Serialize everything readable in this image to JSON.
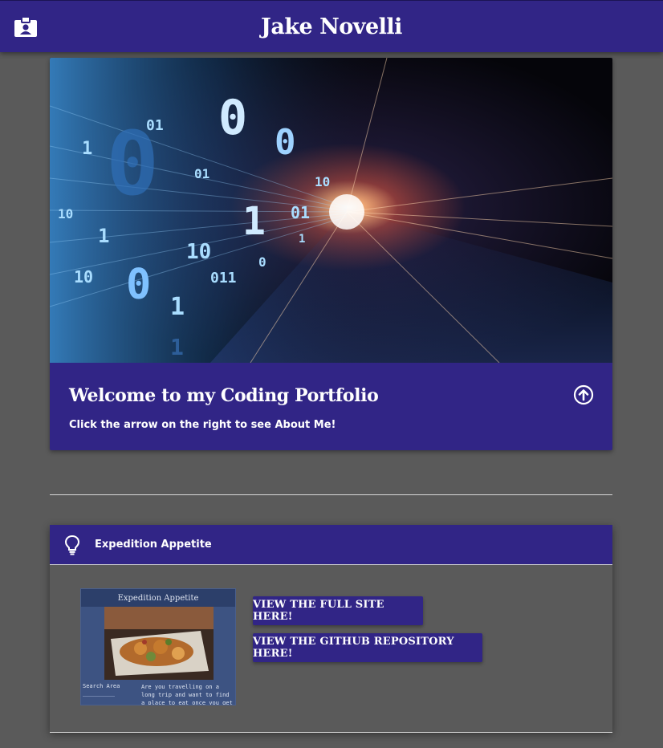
{
  "header": {
    "title": "Jake Novelli",
    "badge_icon": "id-badge-icon"
  },
  "hero": {
    "title": "Welcome to my Coding Portfolio",
    "subtitle": "Click the arrow on the right to see About Me!",
    "image_icon": "binary-code-tunnel-image",
    "action_icon": "arrow-circle-up-icon"
  },
  "project": {
    "title": "Expedition Appetite",
    "icon": "lightbulb-icon",
    "thumbnail": {
      "title": "Expedition Appetite",
      "search_label": "Search Area",
      "description": "Are you travelling on a long trip and want to find a place to eat once you get there? Use our app to"
    },
    "buttons": {
      "site_label": "View the full site here!",
      "repo_label": "View the GitHub Repository here!"
    }
  },
  "colors": {
    "primary": "#312586",
    "background": "#5a5a5a",
    "text": "#ffffff"
  }
}
